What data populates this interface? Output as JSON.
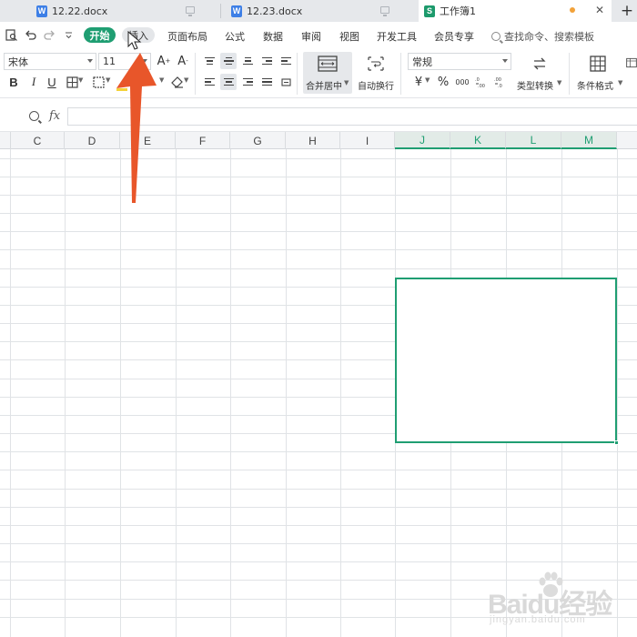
{
  "tabs": [
    {
      "label": "12.22.docx",
      "type": "word",
      "active": false
    },
    {
      "label": "12.23.docx",
      "type": "word",
      "active": false
    },
    {
      "label": "工作簿1",
      "type": "sheet",
      "active": true
    }
  ],
  "tab_icons": {
    "word": "W",
    "sheet": "S",
    "add": "+"
  },
  "menu": {
    "items": [
      "开始",
      "插入",
      "页面布局",
      "公式",
      "数据",
      "审阅",
      "视图",
      "开发工具",
      "会员专享"
    ],
    "active": "开始",
    "hovered": "插入",
    "search_placeholder": "查找命令、搜索模板"
  },
  "toolbar": {
    "font_name": "宋体",
    "font_size": "11",
    "bold": "B",
    "italic": "I",
    "underline": "U",
    "merge_center": "合并居中",
    "wrap_text": "自动换行",
    "number_format": "常规",
    "currency": "¥",
    "percent": "%",
    "thousands": "000",
    "type_convert": "类型转换",
    "conditional_format": "条件格式"
  },
  "formula_bar": {
    "fx_label": "fx",
    "value": ""
  },
  "grid": {
    "columns": [
      "C",
      "D",
      "E",
      "F",
      "G",
      "H",
      "I",
      "J",
      "K",
      "L",
      "M"
    ],
    "highlighted_columns": [
      "J",
      "K",
      "L",
      "M"
    ]
  },
  "colors": {
    "accent": "#1f9e72",
    "arrow": "#e8562a",
    "word_icon": "#3d7fe6",
    "unsaved_dot": "#f2a23a"
  },
  "watermark": {
    "main": "Baidu经验",
    "sub": "jingyan.baidu.com"
  }
}
